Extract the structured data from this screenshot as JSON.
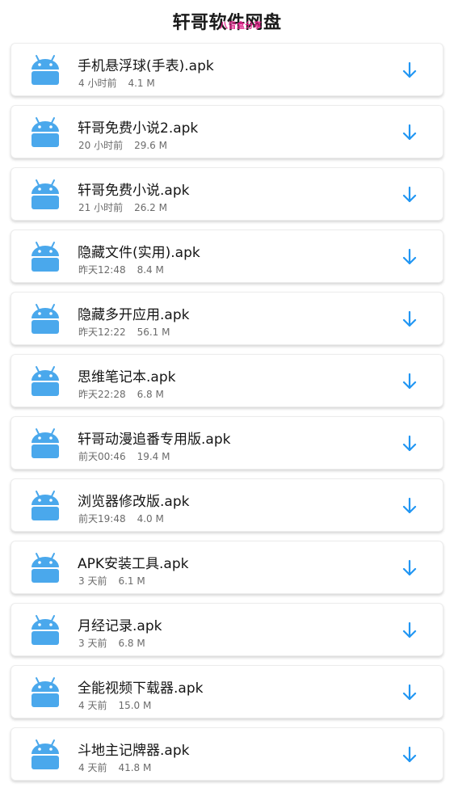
{
  "header": {
    "title": "轩哥软件网盘",
    "watermark": "八音盒分享"
  },
  "colors": {
    "android_icon": "#4aa8ec",
    "download_icon": "#2196f3",
    "watermark": "#e0218a"
  },
  "icons": {
    "app": "android-icon",
    "action": "arrow-down-icon"
  },
  "files": [
    {
      "name": "手机悬浮球(手表).apk",
      "time": "4 小时前",
      "size": "4.1 M"
    },
    {
      "name": "轩哥免费小说2.apk",
      "time": "20 小时前",
      "size": "29.6 M"
    },
    {
      "name": "轩哥免费小说.apk",
      "time": "21 小时前",
      "size": "26.2 M"
    },
    {
      "name": "隐藏文件(实用).apk",
      "time": "昨天12:48",
      "size": "8.4 M"
    },
    {
      "name": "隐藏多开应用.apk",
      "time": "昨天12:22",
      "size": "56.1 M"
    },
    {
      "name": "思维笔记本.apk",
      "time": "昨天22:28",
      "size": "6.8 M"
    },
    {
      "name": "轩哥动漫追番专用版.apk",
      "time": "前天00:46",
      "size": "19.4 M"
    },
    {
      "name": "浏览器修改版.apk",
      "time": "前天19:48",
      "size": "4.0 M"
    },
    {
      "name": "APK安装工具.apk",
      "time": "3 天前",
      "size": "6.1 M"
    },
    {
      "name": "月经记录.apk",
      "time": "3 天前",
      "size": "6.8 M"
    },
    {
      "name": "全能视频下载器.apk",
      "time": "4 天前",
      "size": "15.0 M"
    },
    {
      "name": "斗地主记牌器.apk",
      "time": "4 天前",
      "size": "41.8 M"
    }
  ]
}
